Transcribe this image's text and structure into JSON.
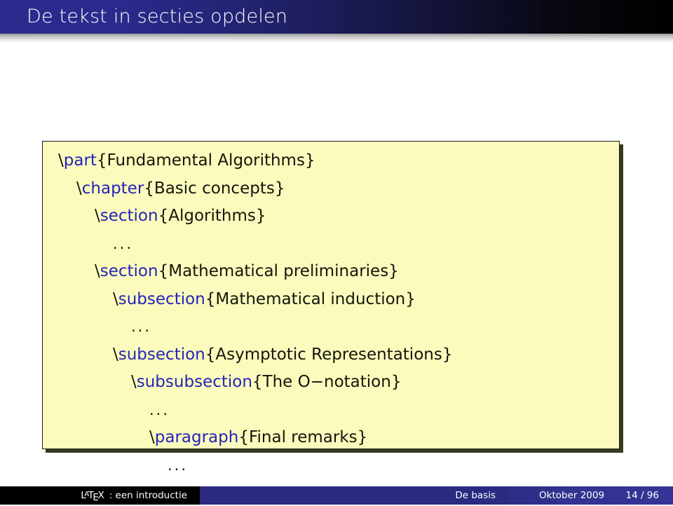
{
  "header": {
    "title": "De tekst in secties opdelen",
    "bar_gradient_start": "#2b2b8f",
    "bar_gradient_end": "#000000",
    "title_color": "#ffffff"
  },
  "code_block": {
    "background": "#fbfbbd",
    "border_color": "#1c1c16",
    "command_color": "#2424bb",
    "text_color": "#15150c",
    "lines": [
      {
        "indent": 0,
        "prefix": "\\",
        "command": "part",
        "argument": "{Fundamental Algorithms}",
        "is_dots": false
      },
      {
        "indent": 1,
        "prefix": "\\",
        "command": "chapter",
        "argument": "{Basic concepts}",
        "is_dots": false
      },
      {
        "indent": 2,
        "prefix": "\\",
        "command": "section",
        "argument": "{Algorithms}",
        "is_dots": false
      },
      {
        "indent": 3,
        "prefix": "",
        "command": "",
        "argument": "...",
        "is_dots": true
      },
      {
        "indent": 2,
        "prefix": "\\",
        "command": "section",
        "argument": "{Mathematical preliminaries}",
        "is_dots": false
      },
      {
        "indent": 3,
        "prefix": "\\",
        "command": "subsection",
        "argument": "{Mathematical induction}",
        "is_dots": false
      },
      {
        "indent": 4,
        "prefix": "",
        "command": "",
        "argument": "...",
        "is_dots": true
      },
      {
        "indent": 3,
        "prefix": "\\",
        "command": "subsection",
        "argument": "{Asymptotic Representations}",
        "is_dots": false
      },
      {
        "indent": 4,
        "prefix": "\\",
        "command": "subsubsection",
        "argument": "{The O−notation}",
        "is_dots": false
      },
      {
        "indent": 5,
        "prefix": "",
        "command": "",
        "argument": "...",
        "is_dots": true
      },
      {
        "indent": 5,
        "prefix": "\\",
        "command": "paragraph",
        "argument": "{Final remarks}",
        "is_dots": false
      },
      {
        "indent": 6,
        "prefix": "",
        "command": "",
        "argument": "...",
        "is_dots": true
      }
    ]
  },
  "footer": {
    "author": "LaTeX: een introductie",
    "author_latex_parts": {
      "l": "L",
      "a": "A",
      "t": "T",
      "e": "E",
      "x": "X",
      "suffix": ": een introductie"
    },
    "section": "De basis",
    "date": "Oktober 2009",
    "page": "14 / 96",
    "left_bg": "#000000",
    "mid_bg": "#2a2a80",
    "right_bg": "#343496"
  }
}
